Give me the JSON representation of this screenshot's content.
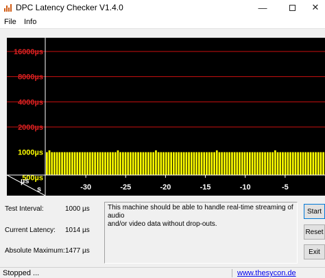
{
  "window": {
    "title": "DPC Latency Checker V1.4.0",
    "minimize_glyph": "—",
    "close_glyph": "✕"
  },
  "menu": [
    "File",
    "Info"
  ],
  "chart_data": {
    "type": "bar",
    "y_tick_labels": [
      "16000µs",
      "8000µs",
      "4000µs",
      "2000µs",
      "1000µs",
      "500µs"
    ],
    "y_axis_unit": "µs",
    "x_axis_unit": "s",
    "x_tick_values": [
      -30,
      -25,
      -20,
      -15,
      -10,
      -5
    ],
    "x_tick_labels": [
      "-30",
      "-25",
      "-20",
      "-15",
      "-10",
      "-5"
    ],
    "x_range": [
      -35,
      0
    ],
    "values_us": [
      1000,
      1050,
      1000,
      1000,
      1000,
      1000,
      1000,
      1000,
      1000,
      1000,
      1000,
      1000,
      1000,
      1000,
      1000,
      1000,
      1000,
      1000,
      1000,
      1000,
      1000,
      1000,
      1000,
      1000,
      1000,
      1000,
      1000,
      1000,
      1050,
      1000,
      1000,
      1000,
      1000,
      1000,
      1000,
      1000,
      1000,
      1000,
      1000,
      1000,
      1000,
      1000,
      1000,
      1050,
      1000,
      1000,
      1000,
      1000,
      1000,
      1000,
      1000,
      1000,
      1000,
      1000,
      1000,
      1000,
      1000,
      1000,
      1000,
      1000,
      1000,
      1000,
      1000,
      1000,
      1000,
      1000,
      1000,
      1050,
      1000,
      1000,
      1000,
      1000,
      1000,
      1000,
      1000,
      1000,
      1000,
      1000,
      1000,
      1000,
      1000,
      1000,
      1000,
      1000,
      1000,
      1000,
      1000,
      1000,
      1000,
      1000,
      1050,
      1000,
      1000,
      1000,
      1000,
      1000,
      1000,
      1000,
      1000,
      1000,
      1000,
      1000,
      1000,
      1000,
      1000,
      1000,
      1000,
      1000,
      1000,
      1000
    ],
    "grid": true,
    "colors": {
      "background": "#000000",
      "grid_red": "#cc1111",
      "label_red": "#dd2222",
      "label_yellow": "#ffff00",
      "bar": "#ffff00",
      "axis_white": "#ffffff"
    }
  },
  "info": {
    "test_interval_label": "Test Interval:",
    "test_interval_value": "1000 µs",
    "current_latency_label": "Current Latency:",
    "current_latency_value": "1014 µs",
    "absolute_maximum_label": "Absolute Maximum:",
    "absolute_maximum_value": "1477 µs"
  },
  "message": {
    "line1": "This machine should be able to handle real-time streaming of audio",
    "line2": "and/or video data without drop-outs."
  },
  "buttons": {
    "start": "Start",
    "reset": "Reset",
    "exit": "Exit"
  },
  "status": {
    "text": "Stopped ...",
    "link": "www.thesycon.de"
  }
}
